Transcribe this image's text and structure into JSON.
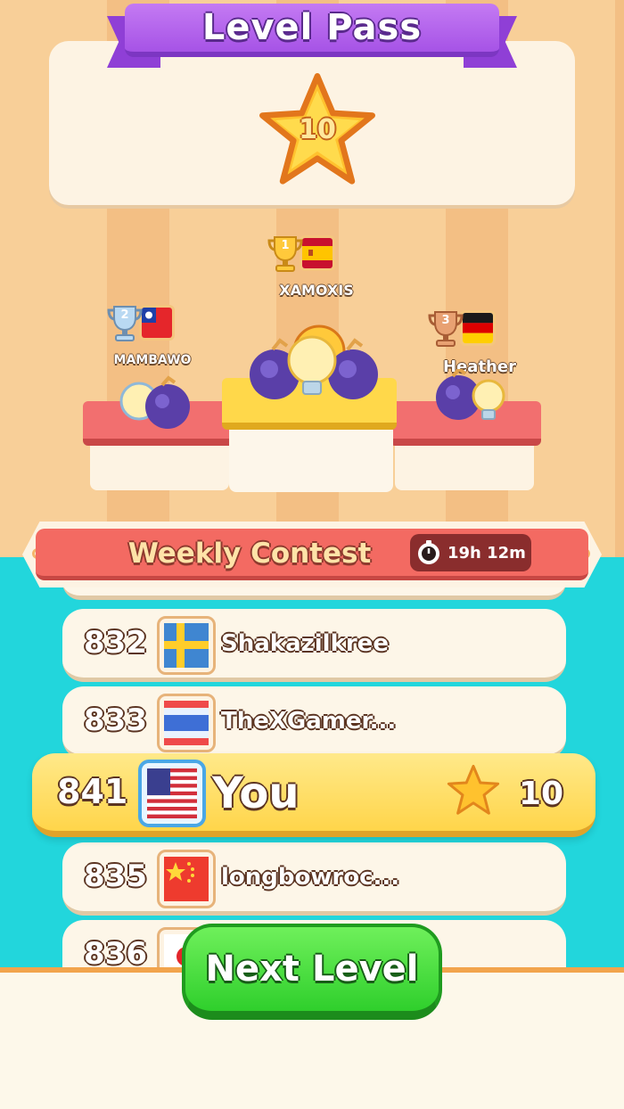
{
  "header": {
    "title": "Level Pass",
    "level_star_value": "10"
  },
  "podium": {
    "first": {
      "rank": "1",
      "name": "XAMOXIS",
      "flag": "spain-flag"
    },
    "second": {
      "rank": "2",
      "name": "MAMBAWO",
      "flag": "taiwan-flag"
    },
    "third": {
      "rank": "3",
      "name": "Heather",
      "flag": "germany-flag"
    }
  },
  "contest": {
    "title": "Weekly Contest",
    "timer": "19h 12m"
  },
  "leaderboard": {
    "rows": [
      {
        "rank": "832",
        "name": "Shakazilkree",
        "flag": "sweden-flag"
      },
      {
        "rank": "833",
        "name": "TheXGamer...",
        "flag": "thailand-flag"
      },
      {
        "rank": "835",
        "name": "longbowroc...",
        "flag": "china-flag"
      },
      {
        "rank": "836",
        "name": "",
        "flag": "japan-flag"
      }
    ],
    "you": {
      "rank": "841",
      "name": "You",
      "flag": "usa-flag",
      "score": "10"
    }
  },
  "buttons": {
    "next_level": "Next Level"
  },
  "colors": {
    "ribbon": "#a653e6",
    "contest_red": "#f36a62",
    "teal_background": "#22d6dc",
    "you_row": "#ffd54a",
    "next_button": "#2fcf2c"
  }
}
